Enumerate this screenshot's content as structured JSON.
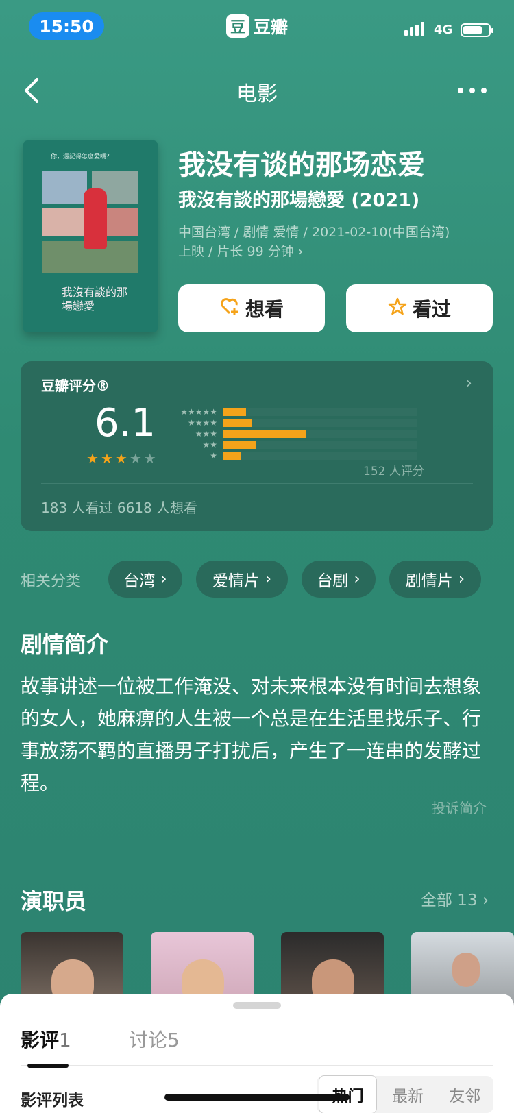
{
  "status_bar": {
    "time": "15:50",
    "app_name": "豆瓣",
    "app_logo": "豆",
    "network": "4G"
  },
  "nav": {
    "title": "电影"
  },
  "movie": {
    "title": "我没有谈的那场恋爱",
    "original_title": "我沒有談的那場戀愛 (2021)",
    "meta_line1": "中国台湾 / 剧情 爱情 / 2021-02-10(中国台湾)",
    "meta_line2": "上映 / 片长 99 分钟 ›",
    "poster_tagline": "你，還記得怎麼愛嗎？",
    "poster_title": "我沒有談的那場戀愛"
  },
  "actions": {
    "want_label": "想看",
    "seen_label": "看过"
  },
  "rating": {
    "label": "豆瓣评分®",
    "score": "6.1",
    "stars": 3,
    "count_label": "152 人评分",
    "footer": "183 人看过    6618 人想看",
    "distribution": [
      {
        "stars": "★★★★★",
        "fraction": 0.12
      },
      {
        "stars": "★★★★",
        "fraction": 0.15
      },
      {
        "stars": "★★★",
        "fraction": 0.43
      },
      {
        "stars": "★★",
        "fraction": 0.17
      },
      {
        "stars": "★",
        "fraction": 0.09
      }
    ]
  },
  "related": {
    "label": "相关分类",
    "chips": [
      "台湾",
      "爱情片",
      "台剧",
      "剧情片"
    ]
  },
  "synopsis": {
    "title": "剧情简介",
    "text": "故事讲述一位被工作淹没、对未来根本没有时间去想象的女人，她麻痹的人生被一个总是在生活里找乐子、行事放荡不羁的直播男子打扰后，产生了一连串的发酵过程。",
    "report_label": "投诉简介"
  },
  "cast": {
    "title": "演职员",
    "all_label": "全部 13 ›"
  },
  "sheet": {
    "tab_reviews": "影评",
    "tab_reviews_count": "1",
    "tab_discuss": "讨论",
    "tab_discuss_count": "5",
    "list_label": "影评列表",
    "segments": [
      "热门",
      "最新",
      "友邻"
    ]
  },
  "colors": {
    "accent": "#f5a31a",
    "bg": "#2f8a72",
    "card": "#2a6b5c"
  }
}
